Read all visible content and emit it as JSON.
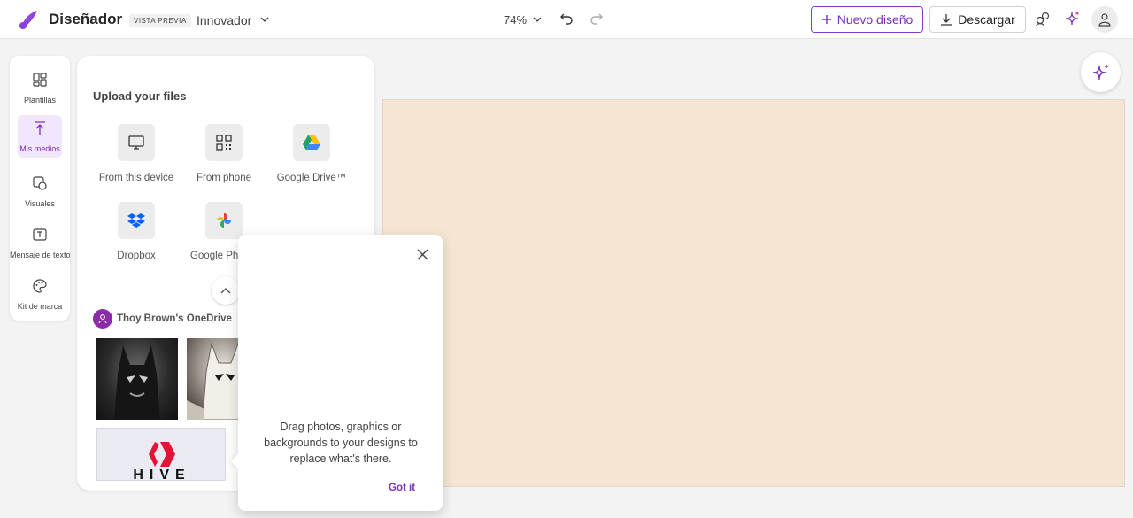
{
  "header": {
    "brand": "Diseñador",
    "preview_badge": "VISTA PREVIA",
    "plan": "Innovador",
    "zoom": "74%",
    "new_design_label": "Nuevo diseño",
    "download_label": "Descargar",
    "accent_color": "#7a2fc0"
  },
  "rail": {
    "items": [
      {
        "label": "Plantillas",
        "icon": "templates-icon"
      },
      {
        "label": "Mis medios",
        "icon": "upload-icon",
        "active": true
      },
      {
        "label": "Visuales",
        "icon": "visuals-icon"
      },
      {
        "label": "Mensaje de texto",
        "icon": "text-icon"
      },
      {
        "label": "Kit de marca",
        "icon": "palette-icon"
      }
    ]
  },
  "panel": {
    "title": "Upload your files",
    "sources": [
      {
        "label": "From this device",
        "icon": "monitor-icon"
      },
      {
        "label": "From phone",
        "icon": "qr-code-icon"
      },
      {
        "label": "Google Drive™",
        "icon": "google-drive-icon"
      },
      {
        "label": "Dropbox",
        "icon": "dropbox-icon"
      },
      {
        "label": "Google Photos",
        "icon": "google-photos-icon"
      }
    ],
    "onedrive_title": "Thoy Brown's OneDrive",
    "hive_text": "HIVE"
  },
  "popover": {
    "message": "Drag photos, graphics or backgrounds to your designs to replace what's there.",
    "ok_label": "Got it"
  },
  "canvas": {
    "background": "#f5e6d3"
  }
}
